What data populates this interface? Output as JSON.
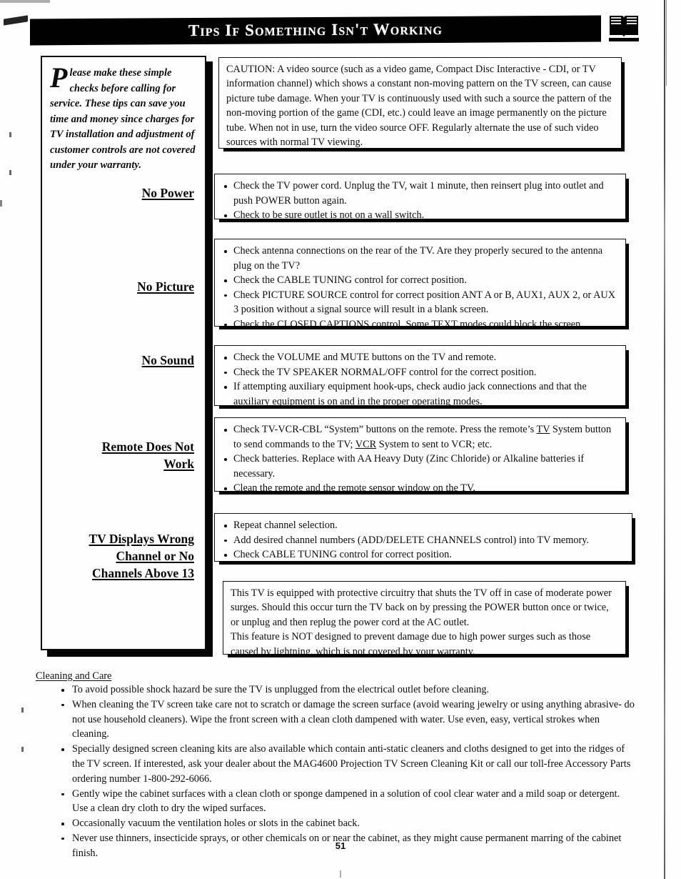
{
  "header": {
    "title": "Tips If Something Isn't Working",
    "icon": "open-book-icon"
  },
  "intro": {
    "dropcap": "P",
    "text": "lease make these simple checks before calling for service.  These tips can save you time and money since charges for TV installation and adjustment of customer controls are not covered under your warranty."
  },
  "caution": {
    "text": "CAUTION: A video source (such as a video game, Compact Disc Interactive - CDI, or TV information channel) which shows a constant non-moving pattern on the TV screen, can cause picture tube damage. When your TV is continuously used with such a source the pattern of the non-moving portion of the game (CDI, etc.) could leave an image permanently on the picture tube. When not in use, turn the video source OFF. Regularly alternate the use of such video sources with normal TV viewing."
  },
  "sections": [
    {
      "label": "No Power",
      "label_lines": [
        "No Power"
      ],
      "items": [
        "Check the TV power cord. Unplug the TV, wait 1 minute, then reinsert plug into outlet and push POWER button again.",
        "Check to be sure outlet is not on a wall switch."
      ]
    },
    {
      "label": "No Picture",
      "label_lines": [
        "No Picture"
      ],
      "items": [
        "Check antenna connections on the rear of the TV. Are they properly secured to the antenna plug on the TV?",
        "Check the CABLE TUNING control for correct position.",
        "Check PICTURE SOURCE control for correct position ANT A or B, AUX1, AUX 2, or AUX 3 position without a signal source will result in a blank screen.",
        "Check the CLOSED CAPTIONS control. Some TEXT modes could block the screen."
      ]
    },
    {
      "label": "No Sound",
      "label_lines": [
        "No Sound"
      ],
      "items": [
        "Check the VOLUME and MUTE buttons on the TV and remote.",
        "Check the TV SPEAKER NORMAL/OFF control for the correct position.",
        "If attempting auxiliary equipment hook-ups, check audio jack connections and that the auxiliary equipment is on and in the proper operating modes."
      ]
    },
    {
      "label": "Remote Does Not Work",
      "label_lines": [
        "Remote Does Not",
        "Work"
      ],
      "items": [
        "Check TV-VCR-CBL “System” buttons on the remote. Press the remote’s TV System button to send commands to the TV; VCR System to sent to VCR; etc.",
        "Check batteries.  Replace with AA Heavy Duty (Zinc Chloride) or Alkaline batteries if necessary.",
        "Clean the remote and the remote sensor window on the TV."
      ],
      "underlined_terms": [
        "TV",
        "VCR"
      ]
    },
    {
      "label": "TV Displays Wrong Channel or No Channels Above 13",
      "label_lines": [
        "TV Displays Wrong",
        "Channel or No",
        "Channels Above 13"
      ],
      "items": [
        "Repeat channel selection.",
        "Add desired channel numbers (ADD/DELETE CHANNELS control) into TV memory.",
        "Check CABLE TUNING control for correct position."
      ]
    }
  ],
  "surge_note": {
    "paragraph1": "This TV is equipped with protective circuitry that shuts the TV off in case of moderate power surges. Should this occur turn the TV back on by pressing the POWER button once or twice, or unplug and then replug the power cord at the AC outlet.",
    "paragraph2": "This feature is NOT designed to prevent damage due to high power surges such as those caused by lightning, which is not covered by your warranty."
  },
  "cleaning": {
    "heading": "Cleaning and Care",
    "items": [
      "To avoid possible shock hazard be sure the TV is unplugged from the electrical outlet before cleaning.",
      "When cleaning the TV screen take care not to scratch or damage the screen surface (avoid wearing jewelry or using anything abrasive- do not use household cleaners). Wipe the front screen with a clean cloth dampened with water.  Use even, easy, vertical strokes when cleaning.",
      "Specially designed screen cleaning kits are also available which contain anti-static cleaners and cloths designed to get into the ridges of the TV screen. If interested, ask your dealer about the MAG4600 Projection TV Screen Cleaning Kit or call our toll-free Accessory Parts ordering number 1-800-292-6066.",
      "Gently wipe the cabinet surfaces with a clean cloth or sponge dampened in a solution of cool clear water and a mild soap or detergent. Use a clean dry cloth to dry the wiped surfaces.",
      "Occasionally vacuum the ventilation holes or slots in the cabinet back.",
      "Never use thinners, insecticide sprays, or other chemicals on or near the cabinet, as they might cause permanent marring of the cabinet finish."
    ]
  },
  "page_number": "51"
}
